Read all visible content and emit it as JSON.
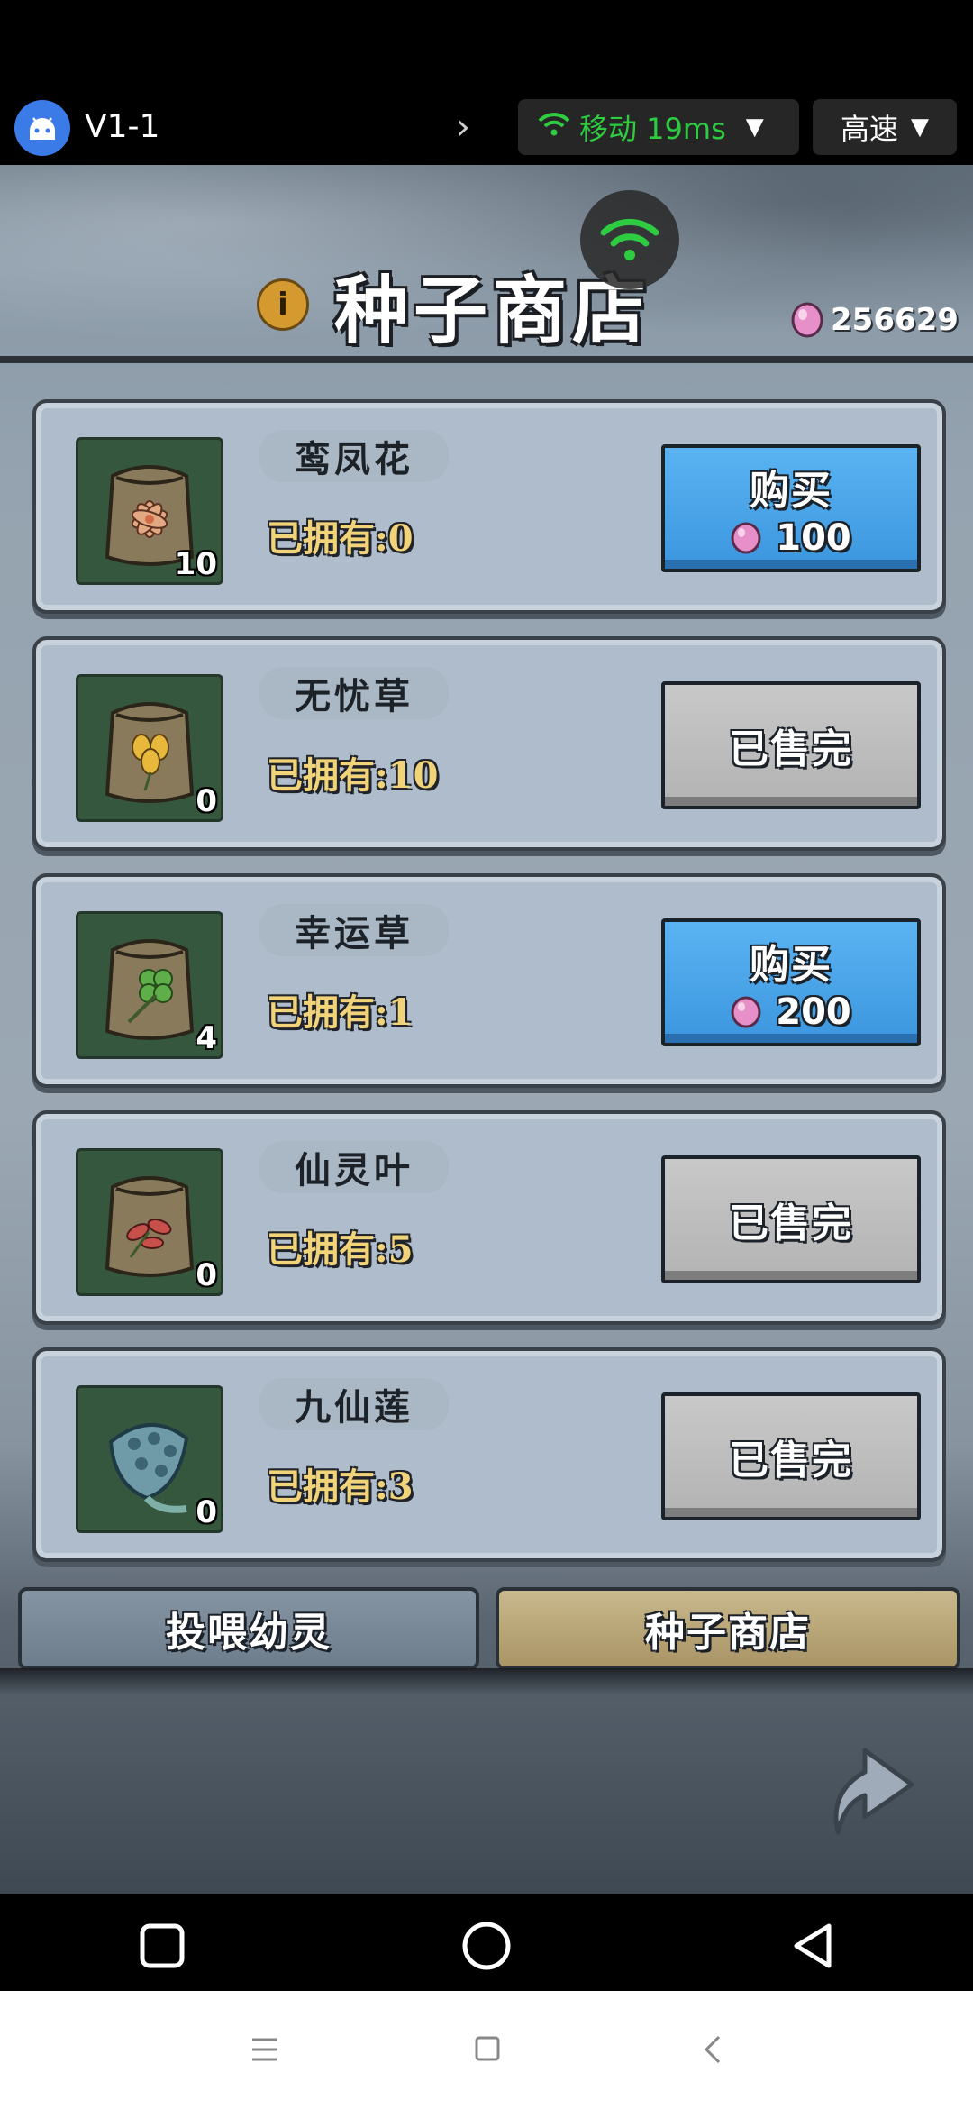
{
  "emulator_bar": {
    "device_name": "V1-1",
    "network_label": "移动 19ms",
    "speed_label": "高速"
  },
  "shop": {
    "title": "种子商店",
    "currency": "256629",
    "items": [
      {
        "name": "鸾凤花",
        "owned": "已拥有:0",
        "stock": "10",
        "status": "buy",
        "button_label": "购买",
        "price": "100",
        "icon": "flower-seed-bag-icon"
      },
      {
        "name": "无忧草",
        "owned": "已拥有:10",
        "stock": "0",
        "status": "sold",
        "button_label": "已售完",
        "price": "",
        "icon": "yellow-flower-seed-bag-icon"
      },
      {
        "name": "幸运草",
        "owned": "已拥有:1",
        "stock": "4",
        "status": "buy",
        "button_label": "购买",
        "price": "200",
        "icon": "clover-seed-bag-icon"
      },
      {
        "name": "仙灵叶",
        "owned": "已拥有:5",
        "stock": "0",
        "status": "sold",
        "button_label": "已售完",
        "price": "",
        "icon": "red-leaf-seed-bag-icon"
      },
      {
        "name": "九仙莲",
        "owned": "已拥有:3",
        "stock": "0",
        "status": "sold",
        "button_label": "已售完",
        "price": "",
        "icon": "lotus-pod-icon"
      }
    ]
  },
  "tabs": {
    "feed": "投喂幼灵",
    "shop": "种子商店"
  },
  "colors": {
    "buy_button": "#4aa6ea",
    "sold_button": "#bdbdbd",
    "owned_text": "#f1d37a",
    "network_green": "#2ecc40"
  }
}
